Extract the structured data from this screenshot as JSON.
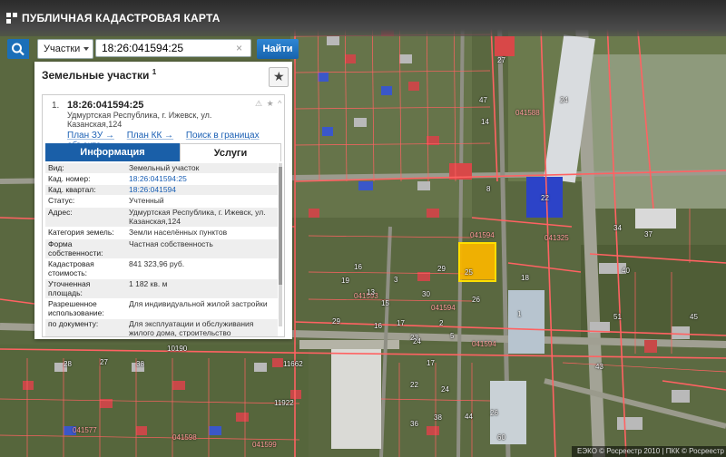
{
  "app": {
    "title": "ПУБЛИЧНАЯ КАДАСТРОВАЯ КАРТА"
  },
  "search": {
    "type_label": "Участки",
    "value": "18:26:041594:25",
    "button_label": "Найти"
  },
  "panel": {
    "title": "Земельные участки",
    "title_sup": "1",
    "result": {
      "number": "1.",
      "cad_number": "18:26:041594:25",
      "address": "Удмуртская Республика, г. Ижевск, ул. Казанская,124",
      "icons": "⚠ ★ ^",
      "links": [
        "План ЗУ →",
        "План КК →",
        "Поиск в границах объекта →"
      ]
    },
    "tabs": [
      "Информация",
      "Услуги"
    ],
    "attributes": [
      {
        "key": "Вид:",
        "value": "Земельный участок"
      },
      {
        "key": "Кад. номер:",
        "value": "18:26:041594:25"
      },
      {
        "key": "Кад. квартал:",
        "value": "18:26:041594"
      },
      {
        "key": "Статус:",
        "value": "Учтенный"
      },
      {
        "key": "Адрес:",
        "value": "Удмуртская Республика, г. Ижевск, ул. Казанская,124"
      },
      {
        "key": "Категория земель:",
        "value": "Земли населённых пунктов"
      },
      {
        "key": "Форма собственности:",
        "value": "Частная собственность"
      },
      {
        "key": "Кадастровая стоимость:",
        "value": "841 323,96 руб."
      },
      {
        "key": "Уточненная площадь:",
        "value": "1 182 кв. м"
      },
      {
        "key": "Разрешенное использование:",
        "value": "Для индивидуальной жилой застройки"
      },
      {
        "key": "по документу:",
        "value": "Для эксплуатации и обслуживания жилого дома, строительство индивидуального жилого дома"
      }
    ]
  },
  "map": {
    "quarter_labels": [
      "041588",
      "041594",
      "041325",
      "041593",
      "041594",
      "041594",
      "041577",
      "041598",
      "041599"
    ],
    "parcel_labels": [
      "10",
      "9",
      "27",
      "47",
      "14",
      "16",
      "29",
      "30",
      "26",
      "8",
      "24",
      "40",
      "19",
      "22",
      "18",
      "1",
      "2",
      "3",
      "5",
      "25",
      "34",
      "37",
      "15",
      "16",
      "17",
      "23",
      "13",
      "29",
      "24",
      "51",
      "45",
      "17",
      "10190",
      "11922",
      "11662",
      "27",
      "38",
      "28",
      "22",
      "24",
      "36",
      "38",
      "44",
      "60",
      "26",
      "43"
    ],
    "copyright": "ЕЭКО © Росреестр 2010 | ПКК © Росреестр"
  },
  "colors": {
    "accent": "#1a5fa8",
    "boundary": "#ff5c5c",
    "selected": "#f5b400"
  }
}
